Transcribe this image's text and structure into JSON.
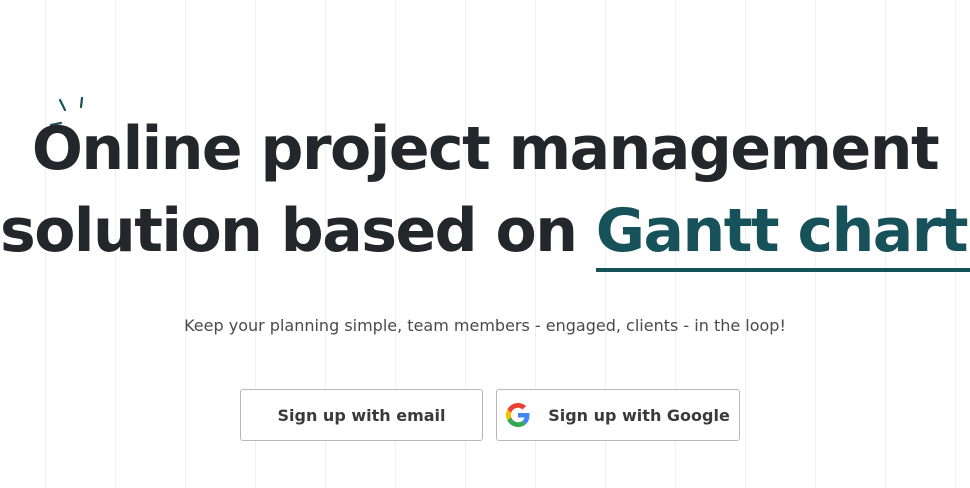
{
  "hero": {
    "headline_line1": "Online project management",
    "headline_line2_prefix": "solution based on ",
    "headline_accent": "Gantt charts",
    "tagline": "Keep your planning simple, team members - engaged, clients - in the loop!"
  },
  "actions": {
    "email_label": "Sign up with email",
    "google_label": "Sign up with Google"
  },
  "colors": {
    "accent": "#17525b",
    "headline": "#23262b",
    "google_blue": "#4285F4",
    "google_red": "#EA4335",
    "google_yellow": "#FBBC05",
    "google_green": "#34A853"
  },
  "icons": {
    "sparkle": "sparkle-icon",
    "google": "google-g-icon"
  }
}
